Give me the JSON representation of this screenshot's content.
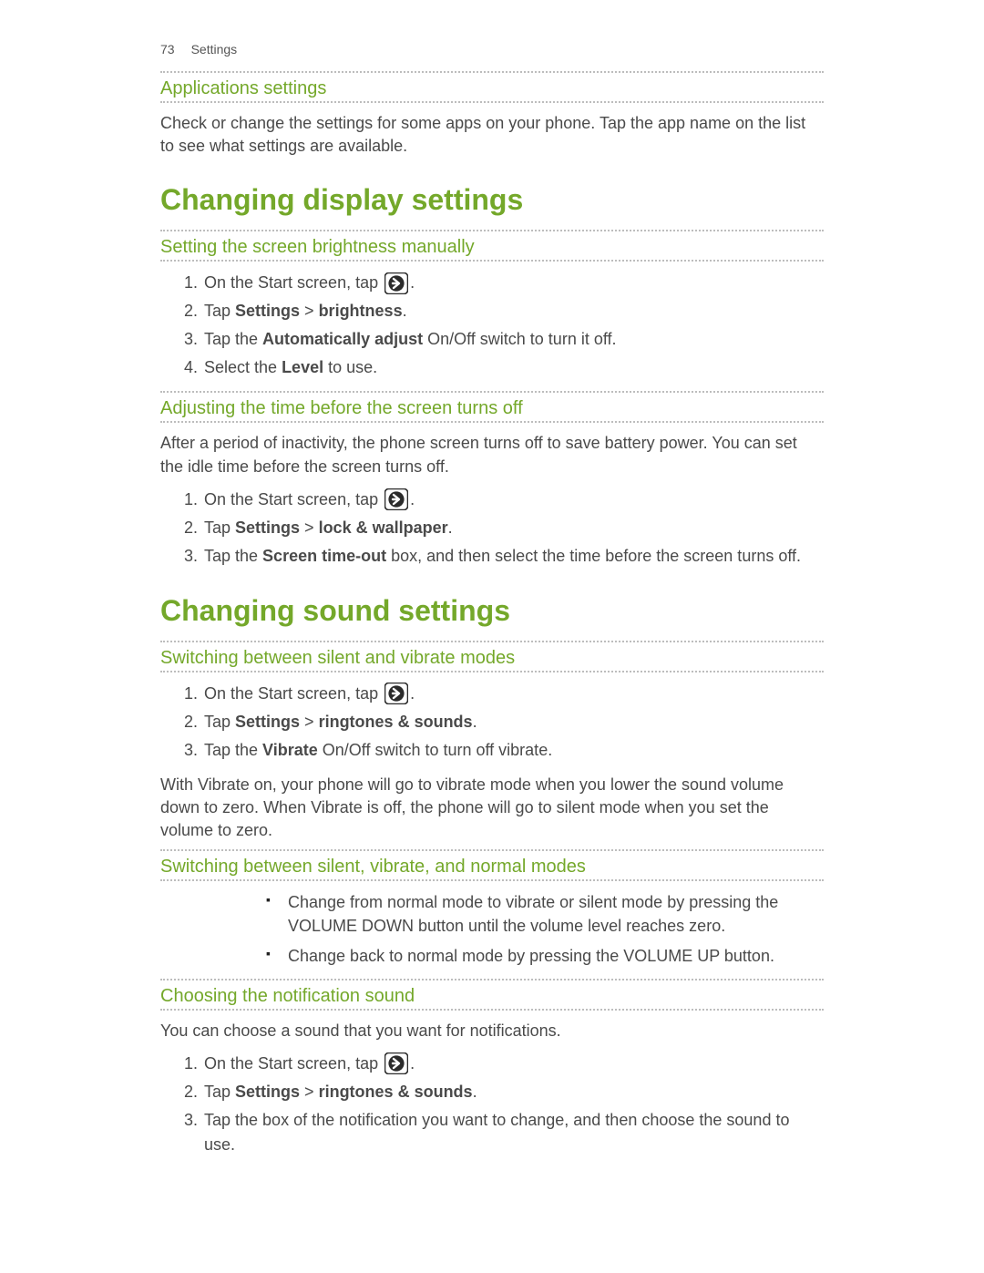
{
  "header": {
    "page_number": "73",
    "section": "Settings"
  },
  "sections": [
    {
      "id": "app_settings",
      "subheading": "Applications settings",
      "paragraphs": [
        "Check or change the settings for some apps on your phone. Tap the app name on the list to see what settings are available."
      ]
    },
    {
      "id": "display",
      "mainheading": "Changing display settings",
      "subsections": [
        {
          "id": "brightness",
          "subheading": "Setting the screen brightness manually",
          "steps": [
            {
              "pre": "On the Start screen, tap ",
              "icon": "arrow-circle-icon",
              "post": "."
            },
            {
              "html": "Tap <b>Settings</b> > <b>brightness</b>."
            },
            {
              "html": "Tap the <b>Automatically adjust</b> On/Off switch to turn it off."
            },
            {
              "html": "Select the <b>Level</b> to use."
            }
          ]
        },
        {
          "id": "timeout",
          "subheading": "Adjusting the time before the screen turns off",
          "paragraphs": [
            "After a period of inactivity, the phone screen turns off to save battery power. You can set the idle time before the screen turns off."
          ],
          "steps": [
            {
              "pre": "On the Start screen, tap ",
              "icon": "arrow-circle-icon",
              "post": "."
            },
            {
              "html": "Tap <b>Settings</b> > <b>lock & wallpaper</b>."
            },
            {
              "html": "Tap the <b>Screen time-out</b> box, and then select the time before the screen turns off."
            }
          ]
        }
      ]
    },
    {
      "id": "sound",
      "mainheading": "Changing sound settings",
      "subsections": [
        {
          "id": "silent_vibrate",
          "subheading": "Switching between silent and vibrate modes",
          "steps": [
            {
              "pre": "On the Start screen, tap ",
              "icon": "arrow-circle-icon",
              "post": "."
            },
            {
              "html": "Tap <b>Settings</b> > <b>ringtones & sounds</b>."
            },
            {
              "html": "Tap the <b>Vibrate</b> On/Off switch to turn off vibrate."
            }
          ],
          "paragraphs_after": [
            "With Vibrate on, your phone will go to vibrate mode when you lower the sound volume down to zero. When Vibrate is off, the phone will go to silent mode when you set the volume to zero."
          ]
        },
        {
          "id": "silent_vibrate_normal",
          "subheading": "Switching between silent, vibrate, and normal modes",
          "bullets": [
            "Change from normal mode to vibrate or silent mode by pressing the VOLUME DOWN button until the volume level reaches zero.",
            "Change back to normal mode by pressing the VOLUME UP button."
          ]
        },
        {
          "id": "notification_sound",
          "subheading": "Choosing the notification sound",
          "paragraphs": [
            "You can choose a sound that you want for notifications."
          ],
          "steps": [
            {
              "pre": "On the Start screen, tap ",
              "icon": "arrow-circle-icon",
              "post": "."
            },
            {
              "html": "Tap <b>Settings</b> > <b>ringtones & sounds</b>."
            },
            {
              "html": "Tap the box of the notification you want to change, and then choose the sound to use."
            }
          ]
        }
      ]
    }
  ]
}
